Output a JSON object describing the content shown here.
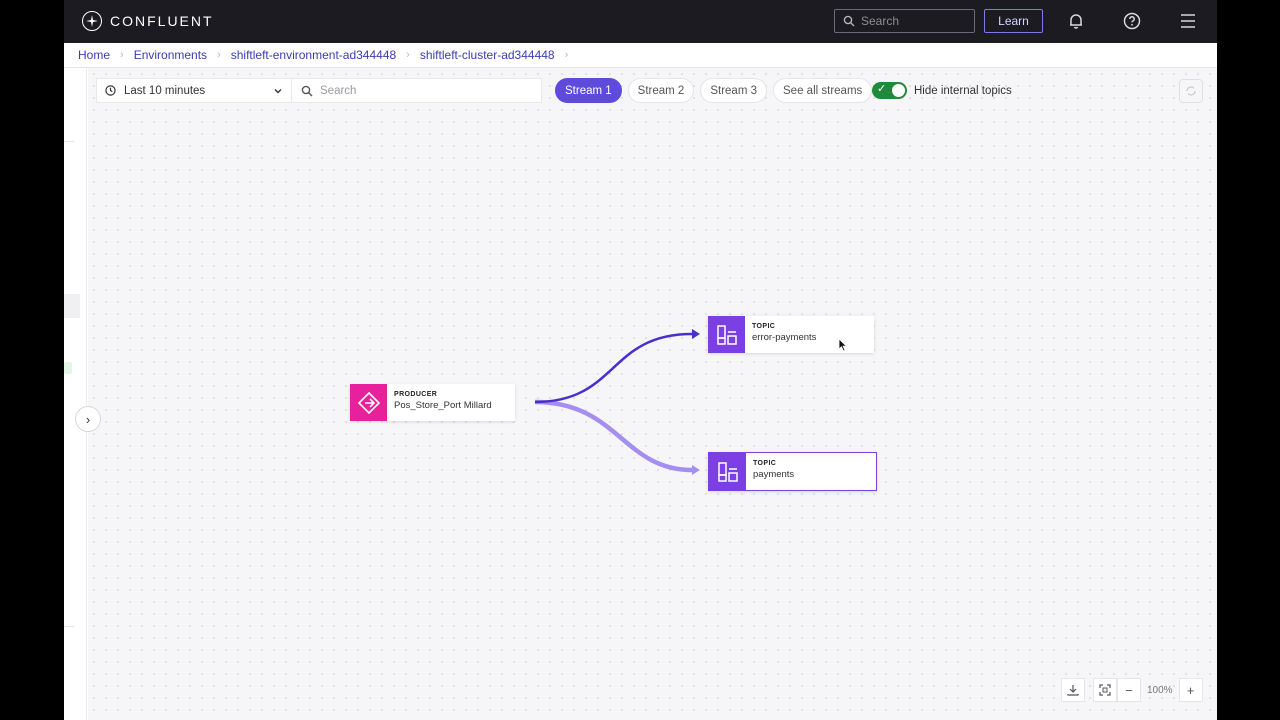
{
  "header": {
    "brand": "CONFLUENT",
    "search_placeholder": "Search",
    "learn_label": "Learn",
    "icons": [
      "bell-icon",
      "help-icon",
      "menu-icon"
    ]
  },
  "breadcrumb": [
    "Home",
    "Environments",
    "shiftleft-environment-ad344448",
    "shiftleft-cluster-ad344448"
  ],
  "toolbar": {
    "time_range": "Last 10 minutes",
    "search_placeholder": "Search",
    "streams": [
      "Stream 1",
      "Stream 2",
      "Stream 3"
    ],
    "active_stream": "Stream 1",
    "see_all_label": "See all streams",
    "hide_internal_label": "Hide internal topics",
    "hide_internal_enabled": true
  },
  "graph": {
    "producer": {
      "kind": "PRODUCER",
      "name": "Pos_Store_Port Millard",
      "color": "#e6219b"
    },
    "topics": [
      {
        "kind": "TOPIC",
        "name": "error-payments",
        "color": "#7b3fe4"
      },
      {
        "kind": "TOPIC",
        "name": "payments",
        "color": "#7b3fe4"
      }
    ],
    "edge_colors": [
      "#4b2fc9",
      "#a48ff0"
    ]
  },
  "zoom": {
    "level": "100%"
  },
  "colors": {
    "accent": "#5f4bdb",
    "topbar": "#1b1b21",
    "toggle_on": "#1f8a3a"
  }
}
